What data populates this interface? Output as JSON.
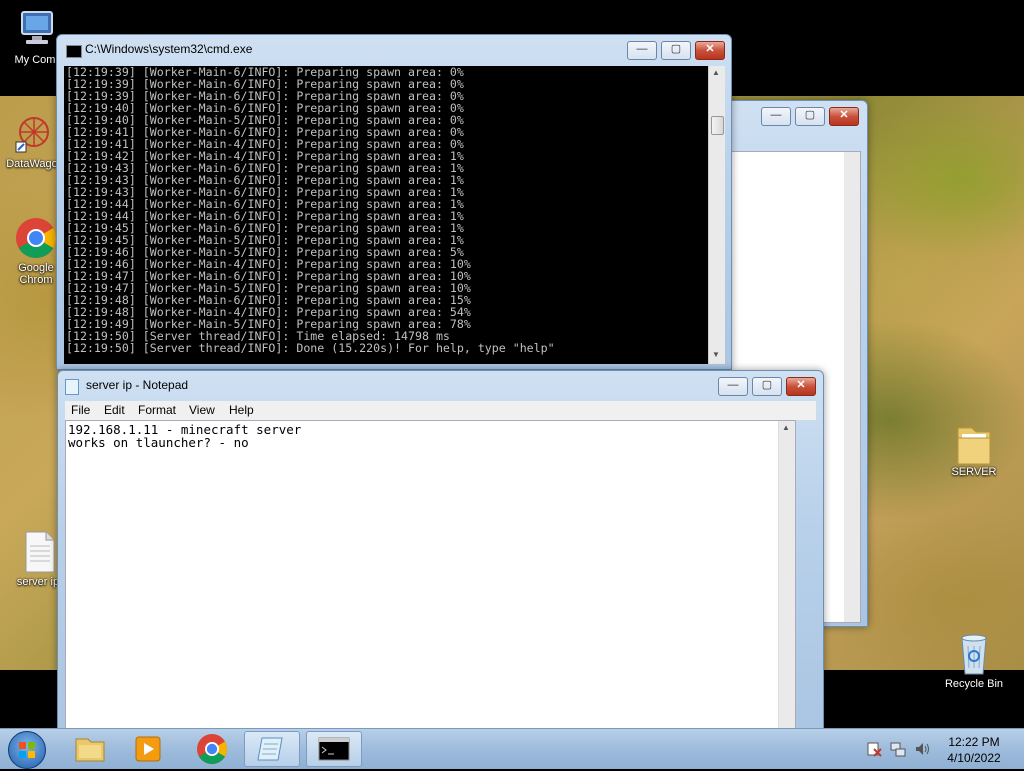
{
  "desktop": {
    "icons": [
      {
        "label": "My Comp"
      },
      {
        "label": "DataWago"
      },
      {
        "label": "Google Chrom"
      },
      {
        "label": "server ip"
      },
      {
        "label": "SERVER"
      },
      {
        "label": "Recycle Bin"
      }
    ]
  },
  "cmd": {
    "title": "C:\\Windows\\system32\\cmd.exe",
    "lines": [
      "[12:19:39] [Worker-Main-6/INFO]: Preparing spawn area: 0%",
      "[12:19:39] [Worker-Main-6/INFO]: Preparing spawn area: 0%",
      "[12:19:39] [Worker-Main-6/INFO]: Preparing spawn area: 0%",
      "[12:19:40] [Worker-Main-6/INFO]: Preparing spawn area: 0%",
      "[12:19:40] [Worker-Main-5/INFO]: Preparing spawn area: 0%",
      "[12:19:41] [Worker-Main-6/INFO]: Preparing spawn area: 0%",
      "[12:19:41] [Worker-Main-4/INFO]: Preparing spawn area: 0%",
      "[12:19:42] [Worker-Main-4/INFO]: Preparing spawn area: 1%",
      "[12:19:43] [Worker-Main-6/INFO]: Preparing spawn area: 1%",
      "[12:19:43] [Worker-Main-6/INFO]: Preparing spawn area: 1%",
      "[12:19:43] [Worker-Main-6/INFO]: Preparing spawn area: 1%",
      "[12:19:44] [Worker-Main-6/INFO]: Preparing spawn area: 1%",
      "[12:19:44] [Worker-Main-6/INFO]: Preparing spawn area: 1%",
      "[12:19:45] [Worker-Main-6/INFO]: Preparing spawn area: 1%",
      "[12:19:45] [Worker-Main-5/INFO]: Preparing spawn area: 1%",
      "[12:19:46] [Worker-Main-5/INFO]: Preparing spawn area: 5%",
      "[12:19:46] [Worker-Main-4/INFO]: Preparing spawn area: 10%",
      "[12:19:47] [Worker-Main-6/INFO]: Preparing spawn area: 10%",
      "[12:19:47] [Worker-Main-5/INFO]: Preparing spawn area: 10%",
      "[12:19:48] [Worker-Main-6/INFO]: Preparing spawn area: 15%",
      "[12:19:48] [Worker-Main-4/INFO]: Preparing spawn area: 54%",
      "[12:19:49] [Worker-Main-5/INFO]: Preparing spawn area: 78%",
      "[12:19:50] [Server thread/INFO]: Time elapsed: 14798 ms",
      "[12:19:50] [Server thread/INFO]: Done (15.220s)! For help, type \"help\""
    ]
  },
  "notepad": {
    "title": "server ip - Notepad",
    "menu": [
      "File",
      "Edit",
      "Format",
      "View",
      "Help"
    ],
    "text": "192.168.1.11 - minecraft server\nworks on tlauncher? - no"
  },
  "taskbar": {
    "time": "12:22 PM",
    "date": "4/10/2022"
  }
}
